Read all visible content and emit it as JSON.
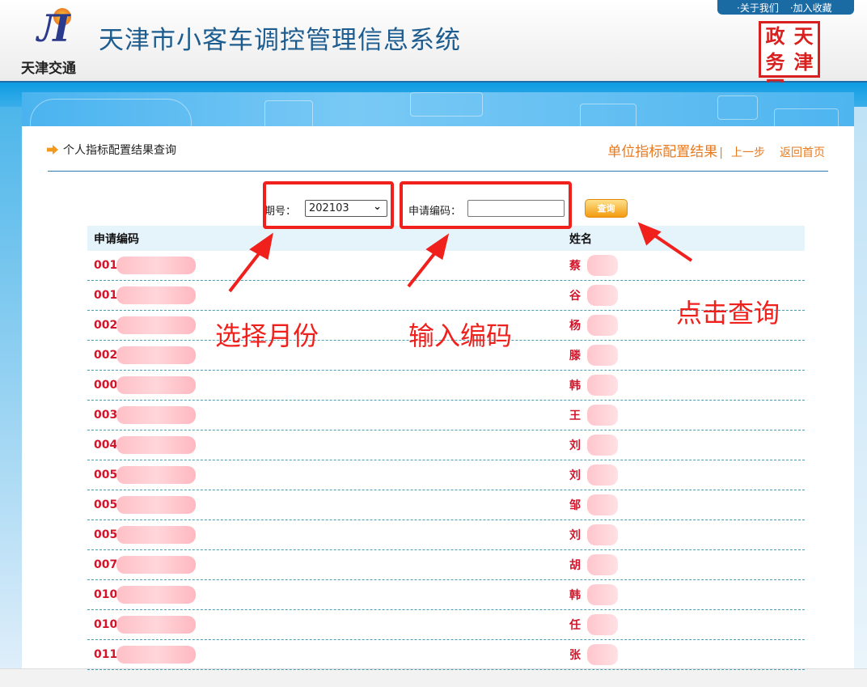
{
  "header": {
    "title": "天津市小客车调控管理信息系统",
    "logo_text": "天津交通",
    "seal_text": [
      "政",
      "天",
      "务",
      "津",
      "网",
      ""
    ],
    "top_links": [
      "·关于我们",
      "·加入收藏"
    ]
  },
  "breadcrumb": "个人指标配置结果查询",
  "nav": {
    "unit_results": "单位指标配置结果",
    "separator": "|",
    "prev_step": "上一步",
    "home": "返回首页"
  },
  "form": {
    "period_label": "期号：",
    "period_value": "202103",
    "code_label": "申请编码：",
    "code_value": "",
    "search_label": "查询"
  },
  "table": {
    "headers": [
      "申请编码",
      "姓名"
    ],
    "rows": [
      [
        "0011",
        "蔡"
      ],
      [
        "0013",
        "谷"
      ],
      [
        "0027",
        "杨"
      ],
      [
        "0028",
        "滕"
      ],
      [
        "000",
        "韩"
      ],
      [
        "003",
        "王"
      ],
      [
        "004",
        "刘"
      ],
      [
        "005",
        "刘"
      ],
      [
        "005",
        "邹"
      ],
      [
        "005",
        "刘"
      ],
      [
        "007",
        "胡"
      ],
      [
        "010",
        "韩"
      ],
      [
        "010",
        "任"
      ],
      [
        "011",
        "张"
      ]
    ]
  },
  "annotations": {
    "select_month": "选择月份",
    "enter_code": "输入编码",
    "click_search": "点击查询"
  },
  "colors": {
    "accent": "#e77a1e",
    "row_text": "#d4142a",
    "annotation": "#f0201c"
  }
}
